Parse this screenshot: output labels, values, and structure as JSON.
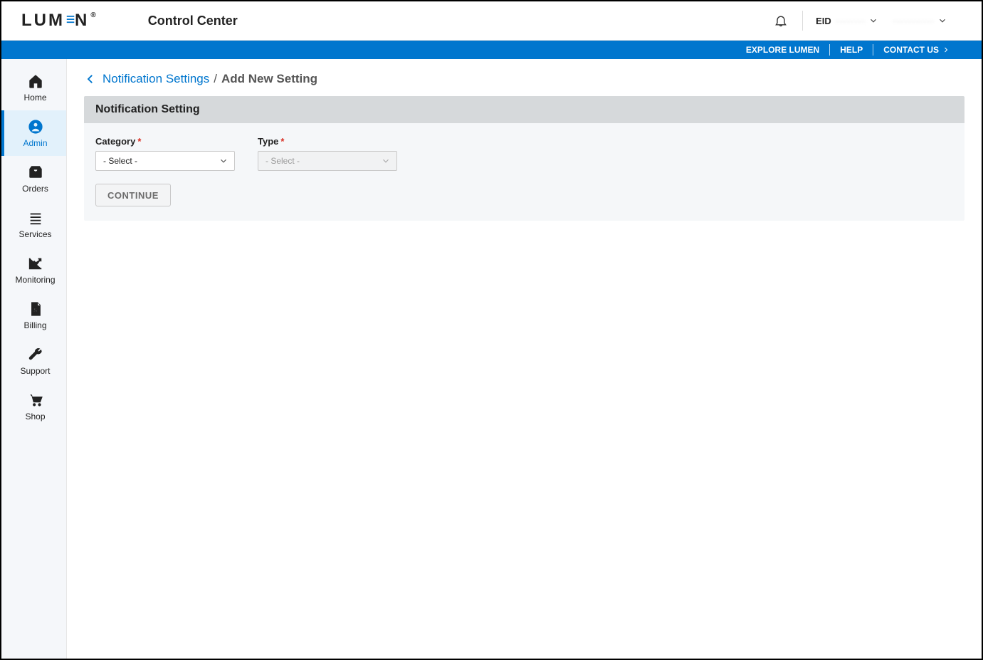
{
  "header": {
    "brand": "LUMEN",
    "app_title": "Control Center",
    "eid_label": "EID",
    "eid_value": "········",
    "user_label": "···········"
  },
  "bluebar": {
    "explore": "EXPLORE LUMEN",
    "help": "HELP",
    "contact": "CONTACT US"
  },
  "sidebar": {
    "items": [
      {
        "label": "Home"
      },
      {
        "label": "Admin"
      },
      {
        "label": "Orders"
      },
      {
        "label": "Services"
      },
      {
        "label": "Monitoring"
      },
      {
        "label": "Billing"
      },
      {
        "label": "Support"
      },
      {
        "label": "Shop"
      }
    ]
  },
  "breadcrumb": {
    "parent": "Notification Settings",
    "separator": "/",
    "current": "Add New Setting"
  },
  "panel": {
    "title": "Notification Setting",
    "form": {
      "category_label": "Category",
      "category_value": "- Select -",
      "type_label": "Type",
      "type_value": "- Select -",
      "continue": "CONTINUE"
    }
  }
}
